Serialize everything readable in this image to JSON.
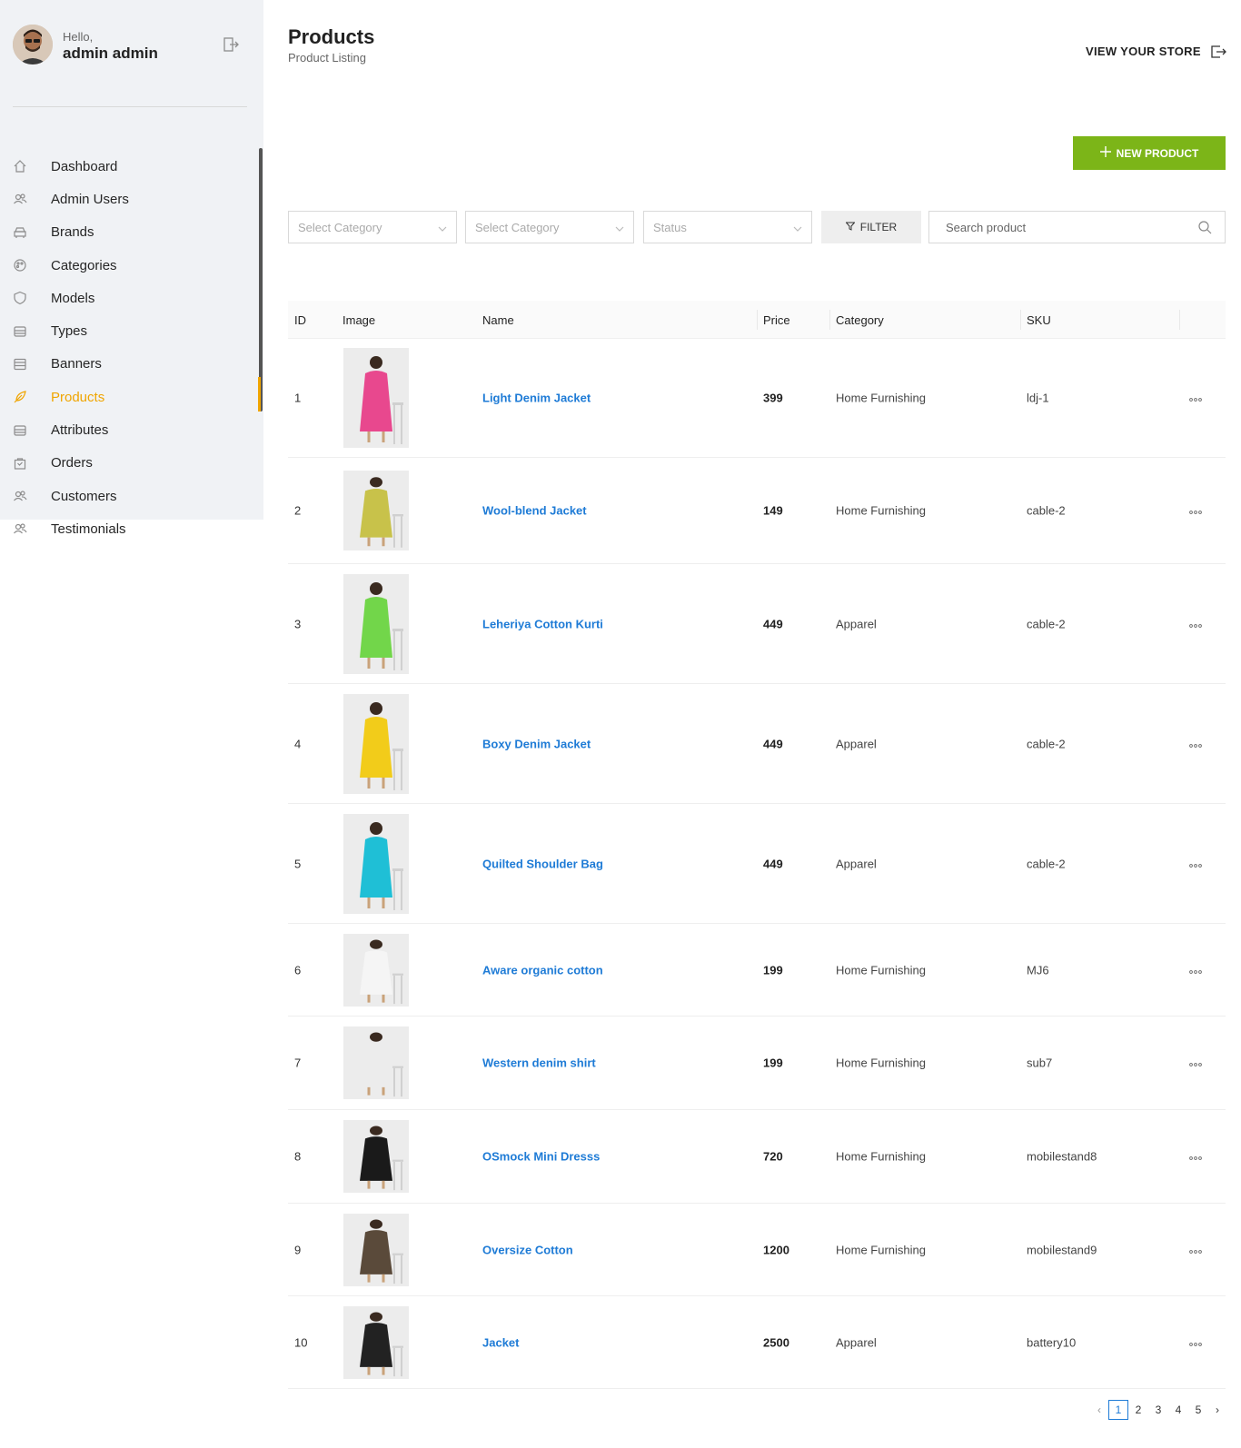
{
  "profile": {
    "greeting": "Hello,",
    "name": "admin admin"
  },
  "sidebar": {
    "items": [
      {
        "label": "Dashboard",
        "icon": "home-icon"
      },
      {
        "label": "Admin Users",
        "icon": "users-icon"
      },
      {
        "label": "Brands",
        "icon": "car-icon"
      },
      {
        "label": "Categories",
        "icon": "palette-icon"
      },
      {
        "label": "Models",
        "icon": "shield-icon"
      },
      {
        "label": "Types",
        "icon": "stack-icon"
      },
      {
        "label": "Banners",
        "icon": "database-icon"
      },
      {
        "label": "Products",
        "icon": "feather-icon",
        "active": true
      },
      {
        "label": "Attributes",
        "icon": "stack-icon"
      },
      {
        "label": "Orders",
        "icon": "bag-icon"
      },
      {
        "label": "Customers",
        "icon": "users-icon"
      },
      {
        "label": "Testimonials",
        "icon": "users-icon"
      }
    ],
    "accent": "#f0a500"
  },
  "header": {
    "title": "Products",
    "subtitle": "Product Listing",
    "view_store": "VIEW YOUR STORE"
  },
  "actions": {
    "new_product": "NEW PRODUCT",
    "accent": "#7cb518"
  },
  "filters": {
    "category_1": "Select Category",
    "category_2": "Select Category",
    "status": "Status",
    "filter_label": "FILTER",
    "search_placeholder": "Search product"
  },
  "table": {
    "columns": [
      "ID",
      "Image",
      "Name",
      "Price",
      "Category",
      "SKU"
    ],
    "rows": [
      {
        "id": "1",
        "name": "Light Denim Jacket",
        "price": "399",
        "category": "Home Furnishing",
        "sku": "ldj-1",
        "image_color": "#e8488e"
      },
      {
        "id": "2",
        "name": "Wool-blend Jacket",
        "price": "149",
        "category": "Home Furnishing",
        "sku": "cable-2",
        "image_color": "#c8c24a"
      },
      {
        "id": "3",
        "name": "Leheriya Cotton Kurti",
        "price": "449",
        "category": "Apparel",
        "sku": "cable-2",
        "image_color": "#72d64a"
      },
      {
        "id": "4",
        "name": "Boxy Denim Jacket",
        "price": "449",
        "category": "Apparel",
        "sku": "cable-2",
        "image_color": "#f2cc1a"
      },
      {
        "id": "5",
        "name": "Quilted Shoulder Bag",
        "price": "449",
        "category": "Apparel",
        "sku": "cable-2",
        "image_color": "#1fbfd6"
      },
      {
        "id": "6",
        "name": "Aware organic cotton",
        "price": "199",
        "category": "Home Furnishing",
        "sku": "MJ6",
        "image_color": "#f5f5f5"
      },
      {
        "id": "7",
        "name": "Western denim shirt",
        "price": "199",
        "category": "Home Furnishing",
        "sku": "sub7",
        "image_color": "#ececec"
      },
      {
        "id": "8",
        "name": "OSmock Mini Dresss",
        "price": "720",
        "category": "Home Furnishing",
        "sku": "mobilestand8",
        "image_color": "#1a1a1a"
      },
      {
        "id": "9",
        "name": "Oversize Cotton",
        "price": "1200",
        "category": "Home Furnishing",
        "sku": "mobilestand9",
        "image_color": "#5a4a3a"
      },
      {
        "id": "10",
        "name": "Jacket",
        "price": "2500",
        "category": "Apparel",
        "sku": "battery10",
        "image_color": "#222222"
      }
    ]
  },
  "pagination": {
    "pages": [
      "1",
      "2",
      "3",
      "4",
      "5"
    ],
    "current": "1",
    "prev": "‹",
    "next": "›"
  },
  "colors": {
    "link": "#1e7bd6"
  }
}
